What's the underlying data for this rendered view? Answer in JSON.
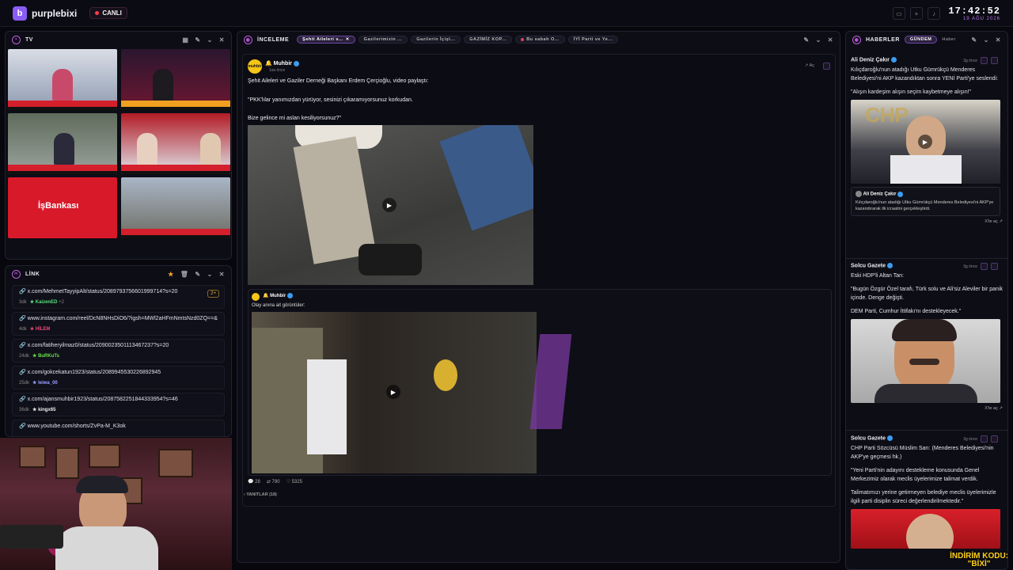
{
  "app": {
    "name": "purplebixi",
    "live_label": "CANLI"
  },
  "clock": {
    "time": "17:42:52",
    "date": "19 AĞU 2026"
  },
  "tv_panel": {
    "title": "TV",
    "tile5_logo": "İşBankası"
  },
  "link_panel": {
    "title": "LİNK",
    "items": [
      {
        "url": "x.com/MehmetTayyipAlt/status/2089793756601999714?s=20",
        "age": "3dk",
        "user": "KaizenED",
        "extra": "+2",
        "badge": "2+",
        "color": "#56e27a"
      },
      {
        "url": "www.instagram.com/reel/DcN8NHsDiO6/?igsh=MWl2aHFmNmtsNzd0ZQ==&i...",
        "age": "4dk",
        "user": "HİLEM",
        "extra": "",
        "badge": "",
        "color": "#e84a7a"
      },
      {
        "url": "x.com/fatiheryilmaz0/status/2090023501113467237?s=20",
        "age": "24dk",
        "user": "BuRKuTs",
        "extra": "",
        "badge": "",
        "color": "#6ae04a"
      },
      {
        "url": "x.com/gokcekatun1923/status/2089945530226892945",
        "age": "25dk",
        "user": "leiwa_00",
        "extra": "",
        "badge": "",
        "color": "#9aa0ff"
      },
      {
        "url": "x.com/ajansmuhbir1923/status/2087582251844333954?s=46",
        "age": "36dk",
        "user": "kingx65",
        "extra": "",
        "badge": "",
        "color": "#f0f0f0"
      },
      {
        "url": "www.youtube.com/shorts/ZvPa-M_K3ok",
        "age": "",
        "user": "",
        "extra": "",
        "badge": "",
        "color": "#ffffff"
      }
    ]
  },
  "center_panel": {
    "title": "İNCELEME",
    "tabs": [
      {
        "label": "Şehit Aileleri v...",
        "active": true
      },
      {
        "label": "Gazilerimizin ...",
        "active": false
      },
      {
        "label": "Gazilerin İçişl...",
        "active": false
      },
      {
        "label": "GAZİMİZ KOP...",
        "active": false
      },
      {
        "label": "Bu sabah O...",
        "active": false
      },
      {
        "label": "İYİ Parti ve Ye...",
        "active": false
      }
    ],
    "post": {
      "author": "Muhbir",
      "time": "1sa önce",
      "action": "Aç",
      "lines": [
        "Şehit Aileleri ve Gaziler Derneği Başkanı Erdem Çerçioğlu, video paylaştı:",
        "\"PKK'lılar yanımızdan yürüyor, sesinizi çıkaramıyorsunuz korkudan.",
        "Bize gelince mi aslan kesiliyorsunuz?\""
      ],
      "quote_author": "Muhbir",
      "quote_text": "Olay anına ait görüntüler:",
      "stats": {
        "replies": "28",
        "retweets": "790",
        "likes": "5325"
      },
      "replies_label": "YANITLAR (18)"
    }
  },
  "news_panel": {
    "title": "HABERLER",
    "tabs": [
      "GÜNDEM",
      "Haber"
    ],
    "items": [
      {
        "source": "Ali Deniz Çakır",
        "time": "3g önce",
        "text": "Kılıçdaroğlu'nun atadığı Utku Gümrükçü Menderes Belediyesi'ni AKP kazandıktan sonra YENİ Parti'ye seslendi:",
        "quote": "\"Alışın kardeşim alışın seçim kaybetmeye alışın!\"",
        "embed_author": "Ali Deniz Çakır",
        "embed_text": "Kılıçdaroğlu'nun atadığı Utku Gümrükçü Menderes Belediyesi'ni AKP'ye kazandırarak ilk icraatini gerçekleştirdi.",
        "open": "X'te aç"
      },
      {
        "source": "Solcu Gazete",
        "time": "3g önce",
        "text": "Eski HDP'li Altan Tan:",
        "quote": "\"Bugün Özgür Özel tarafı, Türk solu ve Ali'siz Aleviler bir panik içinde. Denge değişti.",
        "quote2": "DEM Parti, Cumhur İttifakı'nı destekleyecek.\"",
        "open": "X'te aç"
      },
      {
        "source": "Solcu Gazete",
        "time": "3g önce",
        "text": "CHP Parti Sözcüsü Müslim Sarı: (Menderes Belediyesi'nin AKP'ye geçmesi hk.)",
        "quote": "\"Yeni Parti'nin adayını destekleme konusunda Genel Merkezimiz olarak meclis üyelerimize talimat verdik.",
        "quote2": "Talimatımızı yerine getirmeyen belediye meclis üyelerimizle ilgili parti disiplin süreci değerlendirilmektedir.\""
      }
    ]
  },
  "promo": {
    "line1": "İNDİRİM KODU:",
    "line2": "\"BİXİ\""
  },
  "colors": {
    "accent": "#8a5cf6",
    "live": "#ff3b4e",
    "promo": "#ffd21a"
  }
}
